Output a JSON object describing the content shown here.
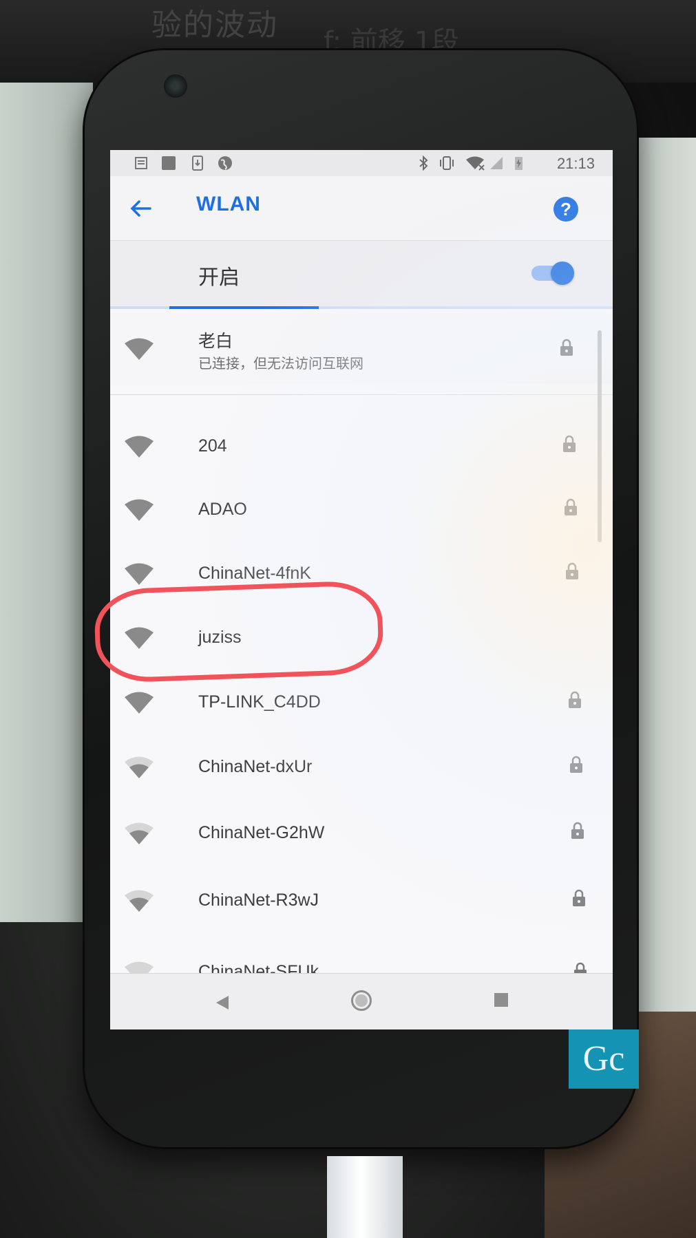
{
  "background": {
    "text_top": "验的波动",
    "text_top2": "f: 前移 1段"
  },
  "status_bar": {
    "time": "21:13",
    "icons": [
      "news-icon",
      "app-icon",
      "download-icon",
      "globe-icon",
      "bluetooth-icon",
      "vibrate-icon",
      "wifi-x-icon",
      "signal-icon",
      "battery-charging-icon"
    ]
  },
  "app_bar": {
    "title": "WLAN",
    "help_label": "?"
  },
  "wifi_switch": {
    "label": "开启",
    "on": true
  },
  "connected_network": {
    "ssid": "老白",
    "status": "已连接，但无法访问互联网",
    "secured": true
  },
  "networks": [
    {
      "ssid": "204",
      "secured": true,
      "signal": "strong"
    },
    {
      "ssid": "ADAO",
      "secured": true,
      "signal": "strong"
    },
    {
      "ssid": "ChinaNet-4fnK",
      "secured": true,
      "signal": "strong"
    },
    {
      "ssid": "juziss",
      "secured": false,
      "signal": "strong"
    },
    {
      "ssid": "TP-LINK_C4DD",
      "secured": true,
      "signal": "strong"
    },
    {
      "ssid": "ChinaNet-dxUr",
      "secured": true,
      "signal": "medium"
    },
    {
      "ssid": "ChinaNet-G2hW",
      "secured": true,
      "signal": "medium"
    },
    {
      "ssid": "ChinaNet-R3wJ",
      "secured": true,
      "signal": "medium"
    },
    {
      "ssid": "ChinaNet-SFUk",
      "secured": true,
      "signal": "weak"
    }
  ],
  "watermark": {
    "text": "Gc"
  },
  "colors": {
    "accent": "#1f6fe0",
    "annotation": "#f2535b",
    "watermark_bg": "#1593b3"
  }
}
